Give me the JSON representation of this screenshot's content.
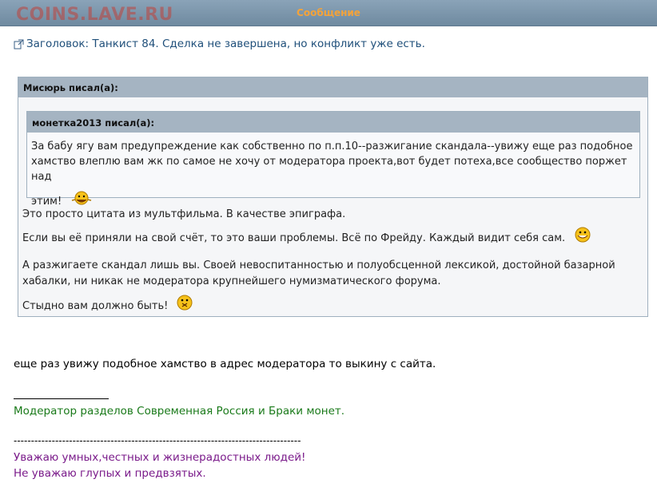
{
  "header": {
    "title": "Сообщение",
    "watermark": "COINS.LAVE.RU"
  },
  "subject": {
    "icon": "external-link-icon",
    "text": "Заголовок: Танкист 84. Сделка не завершена, но конфликт уже есть."
  },
  "quote_outer": {
    "author": "Мисюрь писал(а):",
    "lines": [
      "Это просто цитата из мультфильма. В качестве эпиграфа.",
      "Если вы её приняли на свой счёт, то это ваши проблемы. Всё по Фрейду. Каждый видит себя сам.",
      "А разжигаете скандал лишь вы. Своей невоспитанностью и полуобсценной лексикой, достойной базарной хабалки, ни никак не модератора крупнейшего нумизматического форума.",
      "Стыдно вам должно быть!"
    ]
  },
  "quote_inner": {
    "author": "монетка2013 писал(а):",
    "text_line1": "За бабу ягу вам предупреждение как собственно по п.п.10--разжигание скандала--увижу еще раз подобное",
    "text_line2": "хамство влеплю вам жк по самое не хочу от модератора проекта,вот будет потеха,все сообщество поржет над",
    "text_line3": "этим!"
  },
  "body": {
    "main_text": "еще раз увижу подобное хамство в адрес модератора то выкину с сайта."
  },
  "signature": {
    "moderator": "Модератор разделов Современная Россия и Браки монет.",
    "dashes": "------------------------------------------------------------------------------------",
    "line1": "Уважаю умных,честных и жизнерадостных людей!",
    "line2": "Не уважаю глупых и предвзятых."
  },
  "colors": {
    "header_bg": "#7a93a8",
    "header_title": "#f4a33a",
    "quote_head_bg": "#a5b4c2",
    "subject_link": "#1f4f7a",
    "signature_green": "#1a7a1a",
    "signature_purple": "#7a1a8a"
  }
}
